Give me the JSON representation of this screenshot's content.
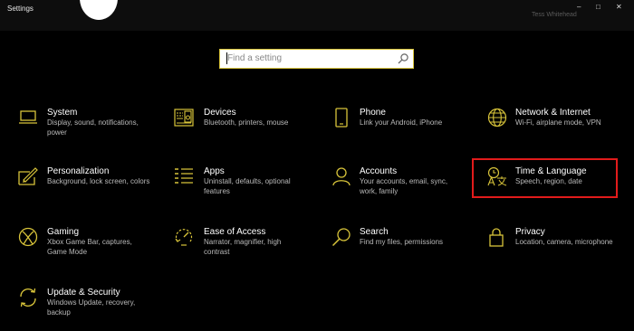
{
  "window": {
    "title": "Settings",
    "user_name": "Tess Whitehead",
    "controls": {
      "minimize": "–",
      "maximize": "□",
      "close": "✕"
    }
  },
  "search": {
    "placeholder": "Find a setting",
    "value": ""
  },
  "accent_color": "#d8c43a",
  "highlight_color": "#e21b1b",
  "highlighted_tile": "time-language",
  "tiles": [
    {
      "id": "system",
      "title": "System",
      "description": "Display, sound, notifications, power",
      "icon": "laptop-icon"
    },
    {
      "id": "devices",
      "title": "Devices",
      "description": "Bluetooth, printers, mouse",
      "icon": "keyboard-speaker-icon"
    },
    {
      "id": "phone",
      "title": "Phone",
      "description": "Link your Android, iPhone",
      "icon": "phone-icon"
    },
    {
      "id": "network",
      "title": "Network & Internet",
      "description": "Wi-Fi, airplane mode, VPN",
      "icon": "globe-icon"
    },
    {
      "id": "personalization",
      "title": "Personalization",
      "description": "Background, lock screen, colors",
      "icon": "paint-icon"
    },
    {
      "id": "apps",
      "title": "Apps",
      "description": "Uninstall, defaults, optional features",
      "icon": "apps-list-icon"
    },
    {
      "id": "accounts",
      "title": "Accounts",
      "description": "Your accounts, email, sync, work, family",
      "icon": "person-icon"
    },
    {
      "id": "time-language",
      "title": "Time & Language",
      "description": "Speech, region, date",
      "icon": "time-language-icon"
    },
    {
      "id": "gaming",
      "title": "Gaming",
      "description": "Xbox Game Bar, captures, Game Mode",
      "icon": "xbox-icon"
    },
    {
      "id": "ease-of-access",
      "title": "Ease of Access",
      "description": "Narrator, magnifier, high contrast",
      "icon": "ease-of-access-icon"
    },
    {
      "id": "search",
      "title": "Search",
      "description": "Find my files, permissions",
      "icon": "magnifier-icon"
    },
    {
      "id": "privacy",
      "title": "Privacy",
      "description": "Location, camera, microphone",
      "icon": "lock-icon"
    },
    {
      "id": "update",
      "title": "Update & Security",
      "description": "Windows Update, recovery, backup",
      "icon": "sync-arrows-icon"
    }
  ]
}
